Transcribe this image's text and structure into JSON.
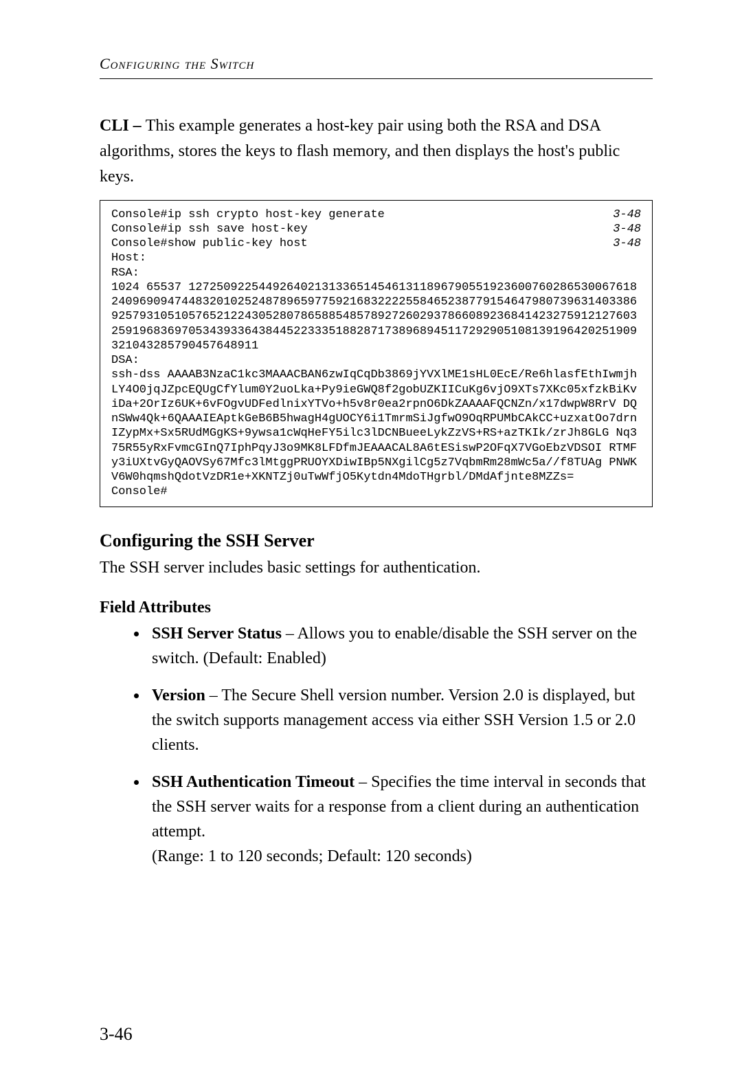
{
  "running_head": "Configuring the Switch",
  "intro": "This example generates a host-key pair using both the RSA and DSA algorithms, stores the keys to flash memory, and then displays the host's public keys.",
  "intro_prefix": "CLI – ",
  "terminal": {
    "cmd_lines": [
      {
        "cmd": "Console#ip ssh crypto host-key generate",
        "ref": "3-48"
      },
      {
        "cmd": "Console#ip ssh save host-key",
        "ref": "3-48"
      },
      {
        "cmd": "Console#show public-key host",
        "ref": "3-48"
      }
    ],
    "output_lines": [
      "Host:",
      "RSA:",
      "1024 65537 1272509225449264021313365145461311896790551923600760286530067618240969094744832010252487896597759216832222558465238779154647980739631403386925793105105765212243052807865885485789272602937866089236841423275912127603259196836970534393364384452233351882871738968945117292905108139196420251909321043285790457648911",
      "DSA:",
      "ssh-dss AAAAB3NzaC1kc3MAAACBAN6zwIqCqDb3869jYVXlME1sHL0EcE/Re6hlasfEthIwmjhLY4O0jqJZpcEQUgCfYlum0Y2uoLka+Py9ieGWQ8f2gobUZKIICuKg6vjO9XTs7XKc05xfzkBiKviDa+2OrIz6UK+6vFOgvUDFedlnixYTVo+h5v8r0ea2rpnO6DkZAAAAFQCNZn/x17dwpW8RrV DQnSWw4Qk+6QAAAIEAptkGeB6B5hwagH4gUOCY6i1TmrmSiJgfwO9OqRPUMbCAkCC+uzxatOo7drnIZypMx+Sx5RUdMGgKS+9ywsa1cWqHeFY5ilc3lDCNBueeLykZzVS+RS+azTKIk/zrJh8GLG Nq375R55yRxFvmcGInQ7IphPqyJ3o9MK8LFDfmJEAAACAL8A6tESiswP2OFqX7VGoEbzVDSOI RTMFy3iUXtvGyQAOVSy67Mfc3lMtggPRUOYXDiwIBp5NXgilCg5z7VqbmRm28mWc5a//f8TUAg PNWKV6W0hqmshQdotVzDR1e+XKNTZj0uTwWfjO5Kytdn4MdoTHgrbl/DMdAfjnte8MZZs=",
      "",
      "Console#"
    ]
  },
  "section_title": "Configuring the SSH Server",
  "section_intro": "The SSH server includes basic settings for authentication.",
  "field_attr_heading": "Field Attributes",
  "fields": [
    {
      "name": "SSH Server Status",
      "desc": " – Allows you to enable/disable the SSH server on the switch. (Default: Enabled)",
      "extra": ""
    },
    {
      "name": "Version",
      "desc": " – The Secure Shell version number. Version 2.0 is displayed, but the switch supports management access via either SSH Version 1.5 or 2.0 clients.",
      "extra": ""
    },
    {
      "name": "SSH Authentication Timeout",
      "desc": " – Specifies the time interval in seconds that the SSH server waits for a response from a client during an authentication attempt.",
      "extra": "(Range: 1 to 120 seconds; Default: 120 seconds)"
    }
  ],
  "page_number": "3-46"
}
